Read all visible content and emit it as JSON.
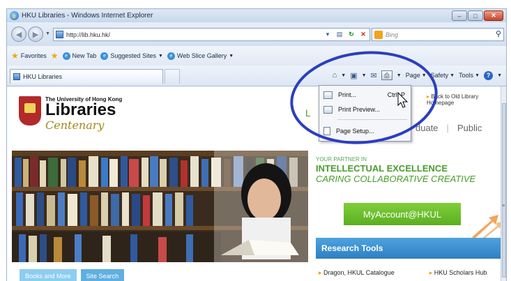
{
  "window": {
    "title": "HKU Libraries - Windows Internet Explorer",
    "controls": {
      "minimize": "–",
      "maximize": "□",
      "close": "✕"
    }
  },
  "address_bar": {
    "url": "http://lib.hku.hk/",
    "search_placeholder": "Bing"
  },
  "favorites_bar": {
    "favorites_label": "Favorites",
    "items": [
      "New Tab",
      "Suggested Sites",
      "Web Slice Gallery"
    ]
  },
  "tab_bar": {
    "active_tab": "HKU Libraries"
  },
  "command_bar": {
    "page_label": "Page",
    "safety_label": "Safety",
    "tools_label": "Tools"
  },
  "print_menu": {
    "items": [
      {
        "label": "Print...",
        "shortcut": "Ctrl+P"
      },
      {
        "label": "Print Preview...",
        "shortcut": ""
      },
      {
        "label": "Page Setup...",
        "shortcut": ""
      }
    ]
  },
  "page": {
    "logo_university": "The University of Hong Kong",
    "logo_libraries": "Libraries",
    "logo_centenary": "Centenary",
    "back_link": "Back to Old Library Homepage",
    "audience_partial_left": "L",
    "audience_partial": "duate",
    "audience_public": "Public",
    "partner_small": "YOUR PARTNER IN",
    "partner_line1": "INTELLECTUAL EXCELLENCE",
    "partner_line2": "CARING COLLABORATIVE CREATIVE",
    "myaccount": "MyAccount@HKUL",
    "research_tools": "Research Tools",
    "research_links": [
      "Dragon, HKUL Catalogue",
      "HKU Scholars Hub"
    ],
    "bottom_tabs": [
      "Books and More",
      "Site Search"
    ]
  },
  "colors": {
    "annotation": "#2b3fbf",
    "brand_green": "#4a9c2b",
    "research_blue": "#2e7fc2"
  }
}
